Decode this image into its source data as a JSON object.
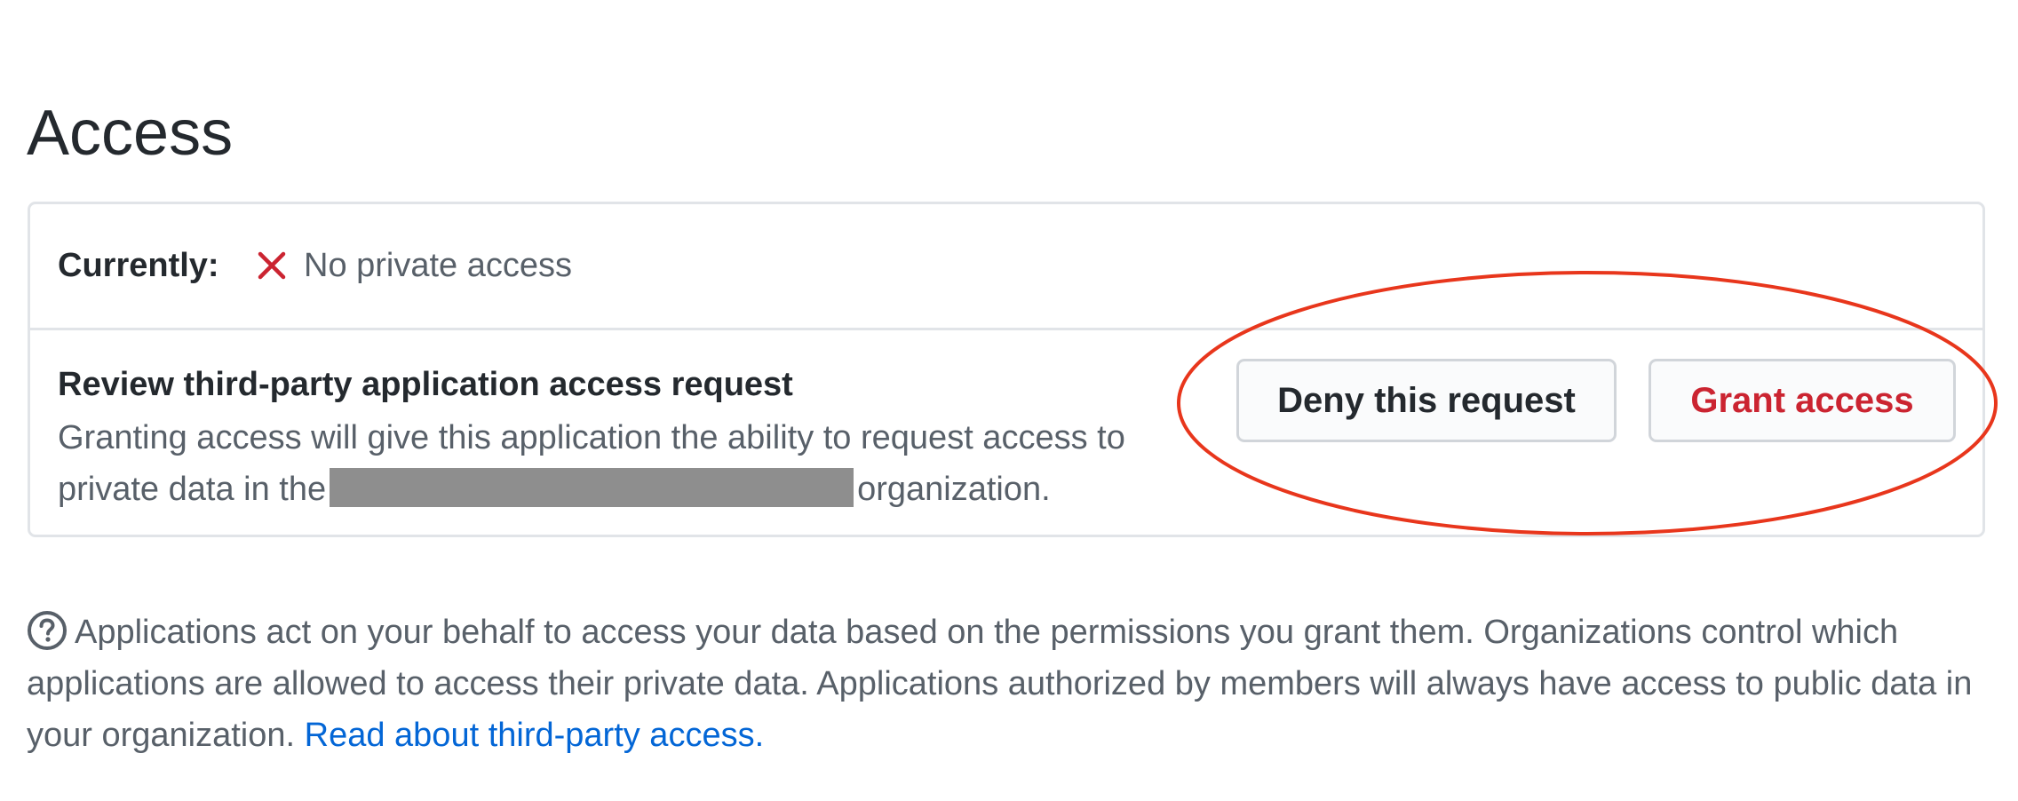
{
  "page": {
    "title": "Access"
  },
  "access": {
    "current_label": "Currently:",
    "current_status": "No private access",
    "status_icon": "x-icon",
    "review_heading": "Review third-party application access request",
    "review_desc_prefix": "Granting access will give this application the ability to request access to private data in the",
    "review_desc_suffix": "organization.",
    "deny_label": "Deny this request",
    "grant_label": "Grant access"
  },
  "help": {
    "icon": "question-circle-icon",
    "text": "Applications act on your behalf to access your data based on the permissions you grant them. Organizations control which applications are allowed to access their private data. Applications authorized by members will always have access to public data in your organization.",
    "link_text": "Read about third-party access."
  },
  "colors": {
    "danger": "#cb2431",
    "link": "#0366d6",
    "annotation": "#e8361c",
    "muted_text": "#586069",
    "border": "#e1e4e8"
  }
}
